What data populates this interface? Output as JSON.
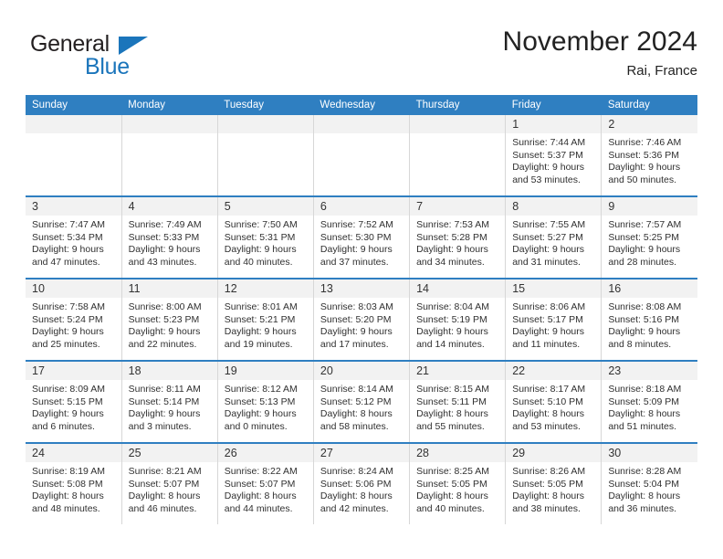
{
  "brand": {
    "name_dark": "General",
    "name_blue": "Blue",
    "triangle_color": "#1b75bb"
  },
  "header": {
    "title": "November 2024",
    "location": "Rai, France",
    "header_bg": "#2f7fc1",
    "daynum_bg": "#f2f2f2"
  },
  "weekday_headers": [
    "Sunday",
    "Monday",
    "Tuesday",
    "Wednesday",
    "Thursday",
    "Friday",
    "Saturday"
  ],
  "labels": {
    "sunrise": "Sunrise:",
    "sunset": "Sunset:",
    "daylight": "Daylight:"
  },
  "weeks": [
    [
      {
        "day": "",
        "empty": true
      },
      {
        "day": "",
        "empty": true
      },
      {
        "day": "",
        "empty": true
      },
      {
        "day": "",
        "empty": true
      },
      {
        "day": "",
        "empty": true
      },
      {
        "day": "1",
        "sunrise": "Sunrise: 7:44 AM",
        "sunset": "Sunset: 5:37 PM",
        "daylight1": "Daylight: 9 hours",
        "daylight2": "and 53 minutes."
      },
      {
        "day": "2",
        "sunrise": "Sunrise: 7:46 AM",
        "sunset": "Sunset: 5:36 PM",
        "daylight1": "Daylight: 9 hours",
        "daylight2": "and 50 minutes."
      }
    ],
    [
      {
        "day": "3",
        "sunrise": "Sunrise: 7:47 AM",
        "sunset": "Sunset: 5:34 PM",
        "daylight1": "Daylight: 9 hours",
        "daylight2": "and 47 minutes."
      },
      {
        "day": "4",
        "sunrise": "Sunrise: 7:49 AM",
        "sunset": "Sunset: 5:33 PM",
        "daylight1": "Daylight: 9 hours",
        "daylight2": "and 43 minutes."
      },
      {
        "day": "5",
        "sunrise": "Sunrise: 7:50 AM",
        "sunset": "Sunset: 5:31 PM",
        "daylight1": "Daylight: 9 hours",
        "daylight2": "and 40 minutes."
      },
      {
        "day": "6",
        "sunrise": "Sunrise: 7:52 AM",
        "sunset": "Sunset: 5:30 PM",
        "daylight1": "Daylight: 9 hours",
        "daylight2": "and 37 minutes."
      },
      {
        "day": "7",
        "sunrise": "Sunrise: 7:53 AM",
        "sunset": "Sunset: 5:28 PM",
        "daylight1": "Daylight: 9 hours",
        "daylight2": "and 34 minutes."
      },
      {
        "day": "8",
        "sunrise": "Sunrise: 7:55 AM",
        "sunset": "Sunset: 5:27 PM",
        "daylight1": "Daylight: 9 hours",
        "daylight2": "and 31 minutes."
      },
      {
        "day": "9",
        "sunrise": "Sunrise: 7:57 AM",
        "sunset": "Sunset: 5:25 PM",
        "daylight1": "Daylight: 9 hours",
        "daylight2": "and 28 minutes."
      }
    ],
    [
      {
        "day": "10",
        "sunrise": "Sunrise: 7:58 AM",
        "sunset": "Sunset: 5:24 PM",
        "daylight1": "Daylight: 9 hours",
        "daylight2": "and 25 minutes."
      },
      {
        "day": "11",
        "sunrise": "Sunrise: 8:00 AM",
        "sunset": "Sunset: 5:23 PM",
        "daylight1": "Daylight: 9 hours",
        "daylight2": "and 22 minutes."
      },
      {
        "day": "12",
        "sunrise": "Sunrise: 8:01 AM",
        "sunset": "Sunset: 5:21 PM",
        "daylight1": "Daylight: 9 hours",
        "daylight2": "and 19 minutes."
      },
      {
        "day": "13",
        "sunrise": "Sunrise: 8:03 AM",
        "sunset": "Sunset: 5:20 PM",
        "daylight1": "Daylight: 9 hours",
        "daylight2": "and 17 minutes."
      },
      {
        "day": "14",
        "sunrise": "Sunrise: 8:04 AM",
        "sunset": "Sunset: 5:19 PM",
        "daylight1": "Daylight: 9 hours",
        "daylight2": "and 14 minutes."
      },
      {
        "day": "15",
        "sunrise": "Sunrise: 8:06 AM",
        "sunset": "Sunset: 5:17 PM",
        "daylight1": "Daylight: 9 hours",
        "daylight2": "and 11 minutes."
      },
      {
        "day": "16",
        "sunrise": "Sunrise: 8:08 AM",
        "sunset": "Sunset: 5:16 PM",
        "daylight1": "Daylight: 9 hours",
        "daylight2": "and 8 minutes."
      }
    ],
    [
      {
        "day": "17",
        "sunrise": "Sunrise: 8:09 AM",
        "sunset": "Sunset: 5:15 PM",
        "daylight1": "Daylight: 9 hours",
        "daylight2": "and 6 minutes."
      },
      {
        "day": "18",
        "sunrise": "Sunrise: 8:11 AM",
        "sunset": "Sunset: 5:14 PM",
        "daylight1": "Daylight: 9 hours",
        "daylight2": "and 3 minutes."
      },
      {
        "day": "19",
        "sunrise": "Sunrise: 8:12 AM",
        "sunset": "Sunset: 5:13 PM",
        "daylight1": "Daylight: 9 hours",
        "daylight2": "and 0 minutes."
      },
      {
        "day": "20",
        "sunrise": "Sunrise: 8:14 AM",
        "sunset": "Sunset: 5:12 PM",
        "daylight1": "Daylight: 8 hours",
        "daylight2": "and 58 minutes."
      },
      {
        "day": "21",
        "sunrise": "Sunrise: 8:15 AM",
        "sunset": "Sunset: 5:11 PM",
        "daylight1": "Daylight: 8 hours",
        "daylight2": "and 55 minutes."
      },
      {
        "day": "22",
        "sunrise": "Sunrise: 8:17 AM",
        "sunset": "Sunset: 5:10 PM",
        "daylight1": "Daylight: 8 hours",
        "daylight2": "and 53 minutes."
      },
      {
        "day": "23",
        "sunrise": "Sunrise: 8:18 AM",
        "sunset": "Sunset: 5:09 PM",
        "daylight1": "Daylight: 8 hours",
        "daylight2": "and 51 minutes."
      }
    ],
    [
      {
        "day": "24",
        "sunrise": "Sunrise: 8:19 AM",
        "sunset": "Sunset: 5:08 PM",
        "daylight1": "Daylight: 8 hours",
        "daylight2": "and 48 minutes."
      },
      {
        "day": "25",
        "sunrise": "Sunrise: 8:21 AM",
        "sunset": "Sunset: 5:07 PM",
        "daylight1": "Daylight: 8 hours",
        "daylight2": "and 46 minutes."
      },
      {
        "day": "26",
        "sunrise": "Sunrise: 8:22 AM",
        "sunset": "Sunset: 5:07 PM",
        "daylight1": "Daylight: 8 hours",
        "daylight2": "and 44 minutes."
      },
      {
        "day": "27",
        "sunrise": "Sunrise: 8:24 AM",
        "sunset": "Sunset: 5:06 PM",
        "daylight1": "Daylight: 8 hours",
        "daylight2": "and 42 minutes."
      },
      {
        "day": "28",
        "sunrise": "Sunrise: 8:25 AM",
        "sunset": "Sunset: 5:05 PM",
        "daylight1": "Daylight: 8 hours",
        "daylight2": "and 40 minutes."
      },
      {
        "day": "29",
        "sunrise": "Sunrise: 8:26 AM",
        "sunset": "Sunset: 5:05 PM",
        "daylight1": "Daylight: 8 hours",
        "daylight2": "and 38 minutes."
      },
      {
        "day": "30",
        "sunrise": "Sunrise: 8:28 AM",
        "sunset": "Sunset: 5:04 PM",
        "daylight1": "Daylight: 8 hours",
        "daylight2": "and 36 minutes."
      }
    ]
  ]
}
